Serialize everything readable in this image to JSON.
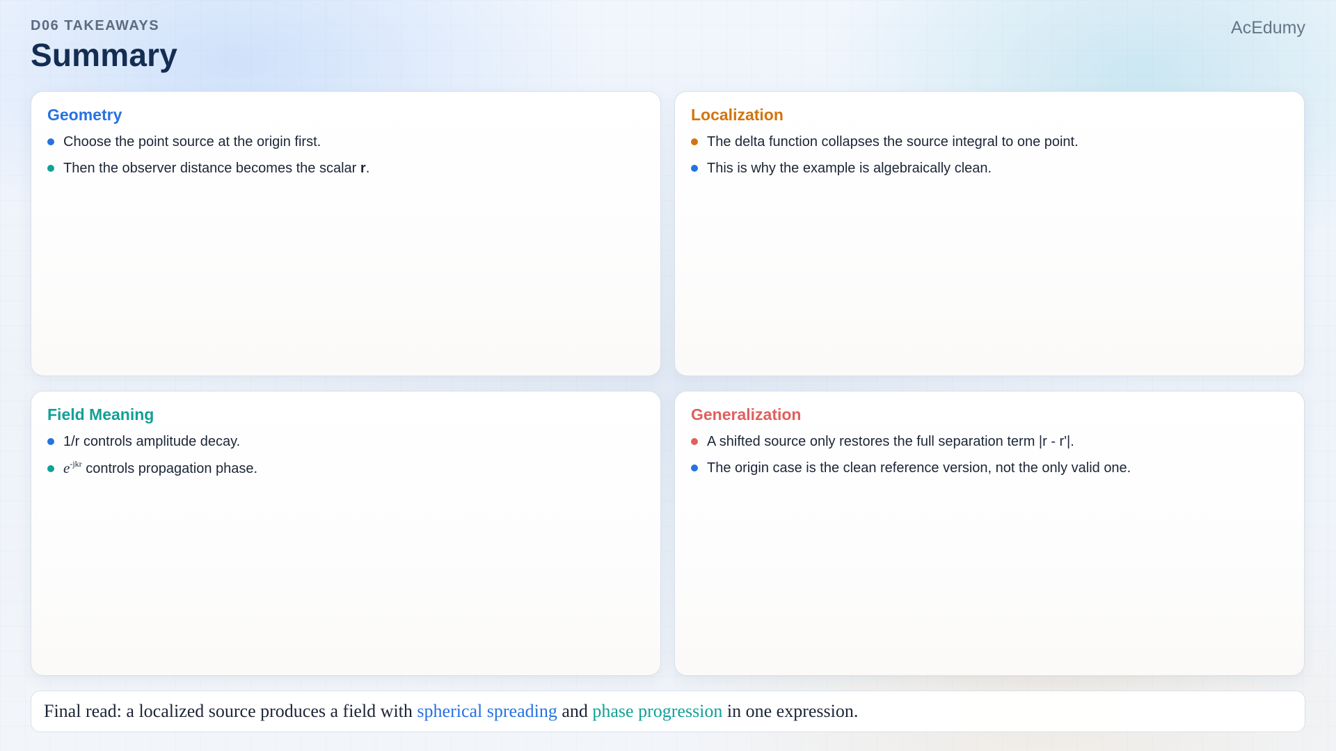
{
  "header": {
    "eyebrow": "D06 TAKEAWAYS",
    "title": "Summary",
    "brand": "AcEdumy"
  },
  "colors": {
    "blue": "#2672e0",
    "orange": "#d2740d",
    "teal": "#12a097",
    "red": "#e0605d",
    "title_navy": "#142d52"
  },
  "cards": {
    "geometry": {
      "title": "Geometry",
      "bullet1": "Choose the point source at the origin first.",
      "bullet2_prefix": "Then the observer distance becomes the scalar ",
      "bullet2_bold": "r",
      "bullet2_suffix": "."
    },
    "localization": {
      "title": "Localization",
      "bullet1": "The delta function collapses the source integral to one point.",
      "bullet2": "This is why the example is algebraically clean."
    },
    "field_meaning": {
      "title": "Field Meaning",
      "bullet1": "1/r controls amplitude decay.",
      "bullet2_math_base": "e",
      "bullet2_math_sup": "-jkr",
      "bullet2_suffix": " controls propagation phase."
    },
    "generalization": {
      "title": "Generalization",
      "bullet1": "A shifted source only restores the full separation term |r - r'|.",
      "bullet2": "The origin case is the clean reference version, not the only valid one."
    }
  },
  "footer": {
    "prefix": "Final read: a localized source produces a field with ",
    "highlight1": "spherical spreading",
    "middle": " and ",
    "highlight2": "phase progression",
    "suffix": " in one expression."
  }
}
